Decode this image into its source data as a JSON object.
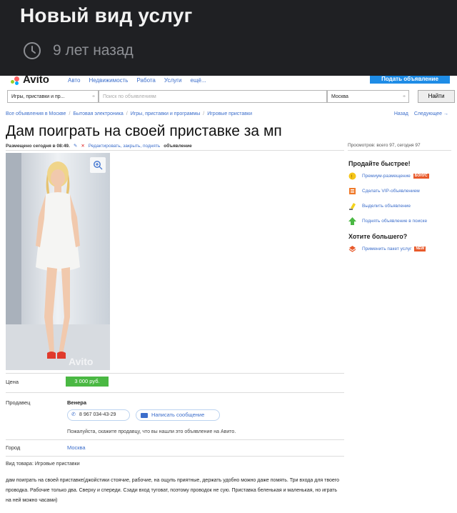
{
  "post": {
    "title": "Новый вид услуг",
    "time": "9 лет назад"
  },
  "site": {
    "logo": "Avito",
    "nav": [
      "Авто",
      "Недвижимость",
      "Работа",
      "Услуги",
      "ещё..."
    ],
    "post_ad_button": "Подать объявление",
    "category_select": "Игры, приставки и пр...",
    "search_placeholder": "Поиск по объявлениям",
    "city_select": "Москва",
    "search_button": "Найти",
    "breadcrumbs": [
      "Все объявления в Москве",
      "Бытовая электроника",
      "Игры, приставки и программы",
      "Игровые приставки"
    ],
    "back_link": "Назад",
    "next_link": "Следующее →"
  },
  "ad": {
    "title": "Дам поиграть на своей приставке за мп",
    "posted": "Размещено сегодня в 08:49.",
    "actions": "Редактировать, закрыть, поднять",
    "actions_suffix": "объявление",
    "views": "Просмотров: всего 97, сегодня 97",
    "watermark": "Avito",
    "price_label": "Цена",
    "price": "3 000 руб.",
    "seller_label": "Продавец",
    "seller_name": "Венера",
    "phone": "8 967 034-43-29",
    "message_button": "Написать сообщение",
    "hint": "Пожалуйста, скажите продавцу, что вы нашли это объявление на Авито.",
    "city_label": "Город",
    "city": "Москва",
    "kind": "Вид товара: Игровые приставки",
    "description": "дам поиграть на своей приставке(джойстики стоячие, рабочие, на ощупь приятные, держать удобно можно даже помять. Три входа для твоего проводка. Рабочие только два. Сверху и спереди. Сзади вход туговат, поэтому проводок не сую. Приставка беленькая и маленькая, но играть на ней можно часами)"
  },
  "sidebar": {
    "sell_faster_title": "Продайте быстрее!",
    "sell_items": [
      {
        "label": "Премиум-размещение",
        "badge": "БОНУС",
        "icon": "coin-icon"
      },
      {
        "label": "Сделать VIP-объявлением",
        "badge": "",
        "icon": "vip-icon"
      },
      {
        "label": "Выделить объявление",
        "badge": "",
        "icon": "highlighter-icon"
      },
      {
        "label": "Поднять объявление в поиске",
        "badge": "",
        "icon": "arrow-up-icon"
      }
    ],
    "want_more_title": "Хотите большего?",
    "package_item": {
      "label": "Применить пакет услуг",
      "badge": "NEW",
      "icon": "package-icon"
    }
  },
  "colors": {
    "link": "#3c6ecb",
    "price_bg": "#4ab843",
    "post_ad_bg": "#1e8ce6",
    "dark_bg": "#1f2023"
  }
}
